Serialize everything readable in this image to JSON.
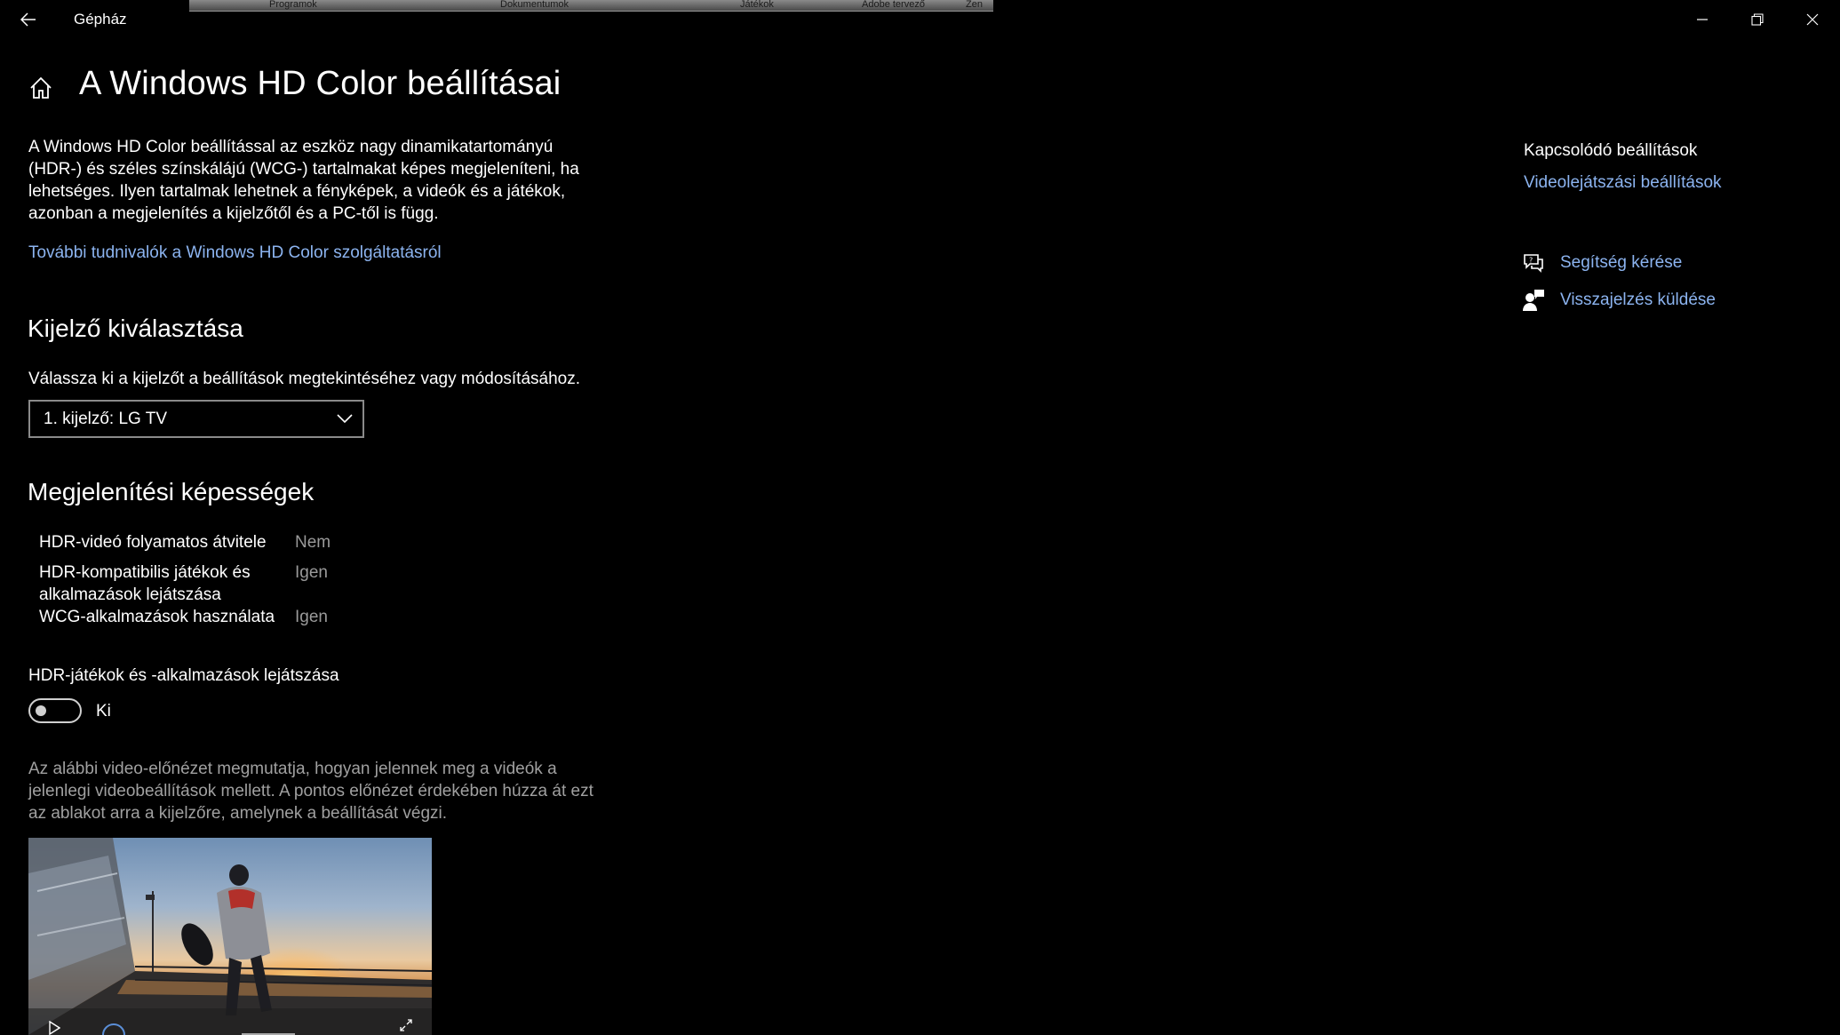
{
  "window": {
    "title": "Gépház",
    "taskstrip": [
      "Programok",
      "Dokumentumok",
      "Játékok",
      "Adobe tervező",
      "Zen"
    ]
  },
  "page": {
    "title": "A Windows HD Color beállításai",
    "description": "A Windows HD Color beállítással az eszköz nagy dinamikatartományú (HDR-) és széles színskálájú (WCG-) tartalmakat képes megjeleníteni, ha lehetséges. Ilyen tartalmak lehetnek a fényképek, a videók és a játékok, azonban a megjelenítés a kijelzőtől és a PC-től is függ.",
    "learn_more_link": "További tudnivalók a Windows HD Color szolgáltatásról"
  },
  "display_select": {
    "heading": "Kijelző kiválasztása",
    "label": "Válassza ki a kijelzőt a beállítások megtekintéséhez vagy módosításához.",
    "selected": "1. kijelző: LG TV"
  },
  "capabilities": {
    "heading": "Megjelenítési képességek",
    "rows": [
      {
        "name": "HDR-videó folyamatos átvitele",
        "value": "Nem"
      },
      {
        "name": "HDR-kompatibilis játékok és alkalmazások lejátszása",
        "value": "Igen"
      },
      {
        "name": "WCG-alkalmazások használata",
        "value": "Igen"
      }
    ]
  },
  "hdr_toggle": {
    "label": "HDR-játékok és -alkalmazások lejátszása",
    "state": "Ki",
    "on": false
  },
  "preview": {
    "description": "Az alábbi video-előnézet megmutatja, hogyan jelennek meg a videók a jelenlegi videobeállítások mellett. A pontos előnézet érdekében húzza át ezt az ablakot arra a kijelzőre, amelynek a beállítását végzi."
  },
  "related": {
    "title": "Kapcsolódó beállítások",
    "link": "Videolejátszási beállítások",
    "help": "Segítség kérése",
    "feedback": "Visszajelzés küldése"
  },
  "icons": {
    "back": "back-arrow-icon",
    "home": "home-icon",
    "minimize": "minimize-icon",
    "restore": "restore-icon",
    "close": "close-icon",
    "dropdown": "chevron-down-icon",
    "help": "help-chat-icon",
    "feedback": "feedback-person-icon",
    "play": "play-icon",
    "fullscreen": "fullscreen-icon"
  },
  "colors": {
    "background": "#000000",
    "link": "#8cb4f0",
    "secondary_text": "#9a9a9a"
  }
}
